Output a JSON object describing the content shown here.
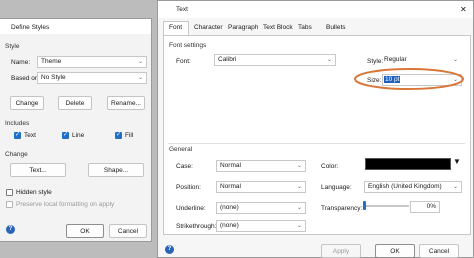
{
  "define_styles": {
    "title": "Define Styles",
    "style_group": "Style",
    "name_label": "Name:",
    "name_value": "Theme",
    "based_on_label": "Based on:",
    "based_on_value": "No Style",
    "change_button": "Change",
    "delete_button": "Delete",
    "rename_button": "Rename...",
    "includes_group": "Includes",
    "include_text": "Text",
    "include_line": "Line",
    "include_fill": "Fill",
    "change_group": "Change",
    "text_button": "Text...",
    "shape_button": "Shape...",
    "hidden_style": "Hidden style",
    "preserve_local": "Preserve local formatting on apply",
    "ok_button": "OK",
    "cancel_button": "Cancel",
    "help_glyph": "?"
  },
  "text_dialog": {
    "title": "Text",
    "tabs": [
      "Font",
      "Character",
      "Paragraph",
      "Text Block",
      "Tabs",
      "Bullets"
    ],
    "font_settings_group": "Font settings",
    "font_label": "Font:",
    "font_value": "Calibri",
    "style_label": "Style:",
    "style_value": "Regular",
    "size_label": "Size:",
    "size_value": "10 pt",
    "general_group": "General",
    "case_label": "Case:",
    "case_value": "Normal",
    "position_label": "Position:",
    "position_value": "Normal",
    "underline_label": "Underline:",
    "underline_value": "(none)",
    "strikethrough_label": "Strikethrough:",
    "strikethrough_value": "(none)",
    "color_label": "Color:",
    "color_value": "#000000",
    "language_label": "Language:",
    "language_value": "English (United Kingdom)",
    "transparency_label": "Transparency:",
    "transparency_value": "0%",
    "apply_button": "Apply",
    "ok_button": "OK",
    "cancel_button": "Cancel",
    "close_glyph": "✕",
    "help_glyph": "?"
  },
  "colors": {
    "checkbox_accent": "#1f6fc9",
    "highlight_ellipse": "#d9773a",
    "size_selection": "#1f5fbf"
  }
}
